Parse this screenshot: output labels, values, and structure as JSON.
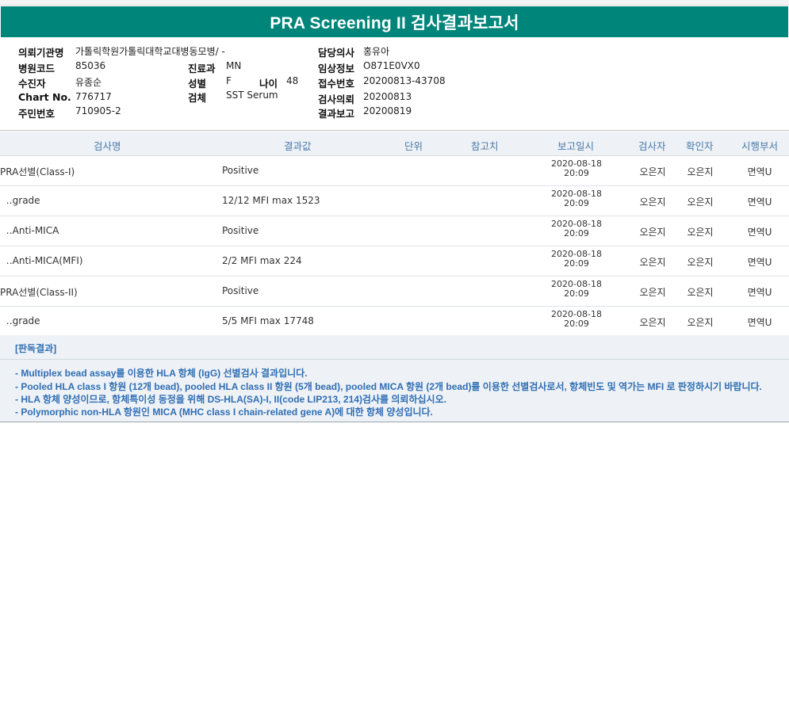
{
  "title": "PRA Screening II 검사결과보고서",
  "patient_info": {
    "institution_label": "의뢰기관명",
    "institution_value": "가톨릭학원가톨릭대학교대병동모병/ -",
    "hospital_code_label": "병원코드",
    "hospital_code_value": "85036",
    "examinee_label": "수진자",
    "examinee_value": "유종순",
    "chart_no_label": "Chart No.",
    "chart_no_value": "776717",
    "resident_no_label": "주민번호",
    "resident_no_value": "710905-2",
    "department_label": "진료과",
    "department_value": "MN",
    "gender_label": "성별",
    "gender_value": "F",
    "age_label": "나이",
    "age_value": "48",
    "specimen_label": "검체",
    "specimen_value": "SST Serum",
    "doctor_label": "담당의사",
    "doctor_value": "홍유아",
    "clinical_info_label": "임상정보",
    "clinical_info_value": "O871E0VX0",
    "receipt_no_label": "접수번호",
    "receipt_no_value": "20200813-43708",
    "request_date_label": "검사의뢰",
    "request_date_value": "20200813",
    "report_date_label": "결과보고",
    "report_date_value": "20200819"
  },
  "table": {
    "headers": {
      "name": "검사명",
      "result": "결과값",
      "unit": "단위",
      "reference": "참고치",
      "report_datetime": "보고일시",
      "tester": "검사자",
      "confirmer": "확인자",
      "department": "시행부서"
    },
    "rows": [
      {
        "name": "PRA선별(Class-I)",
        "result": "Positive",
        "date": "2020-08-18",
        "time": "20:09",
        "tester": "오은지",
        "confirmer": "오은지",
        "department": "면역U"
      },
      {
        "name": "  ‥grade",
        "result": "12/12 MFI max 1523",
        "date": "2020-08-18",
        "time": "20:09",
        "tester": "오은지",
        "confirmer": "오은지",
        "department": "면역U"
      },
      {
        "name": "  ‥Anti-MICA",
        "result": "Positive",
        "date": "2020-08-18",
        "time": "20:09",
        "tester": "오은지",
        "confirmer": "오은지",
        "department": "면역U"
      },
      {
        "name": "  ‥Anti-MICA(MFI)",
        "result": "2/2 MFI max 224",
        "date": "2020-08-18",
        "time": "20:09",
        "tester": "오은지",
        "confirmer": "오은지",
        "department": "면역U"
      },
      {
        "name": "PRA선별(Class-II)",
        "result": "Positive",
        "date": "2020-08-18",
        "time": "20:09",
        "tester": "오은지",
        "confirmer": "오은지",
        "department": "면역U"
      },
      {
        "name": "  ‥grade",
        "result": "5/5 MFI max 17748",
        "date": "2020-08-18",
        "time": "20:09",
        "tester": "오은지",
        "confirmer": "오은지",
        "department": "면역U"
      }
    ]
  },
  "interpretation": {
    "title": "[판독결과]",
    "lines": [
      "- Multiplex bead assay를 이용한 HLA 항체 (IgG) 선별검사 결과입니다.",
      "- Pooled HLA class I 항원 (12개 bead), pooled HLA class II 항원 (5개 bead), pooled MICA 항원 (2개 bead)를 이용한 선별검사로서, 항체빈도 및 역가는 MFI 로 판정하시기 바랍니다.",
      "- HLA 항체 양성이므로, 항체특이성 동정을 위해 DS-HLA(SA)-I, II(code LIP213, 214)검사를 의뢰하십시오.",
      "- Polymorphic non-HLA 항원인 MICA (MHC class I chain-related gene A)에 대한 항체 양성입니다."
    ]
  },
  "colors": {
    "title_bar": "#00857a",
    "header_text": "#4a78a8",
    "note_text": "#2f6db3",
    "panel_bg": "#eef2f6"
  }
}
